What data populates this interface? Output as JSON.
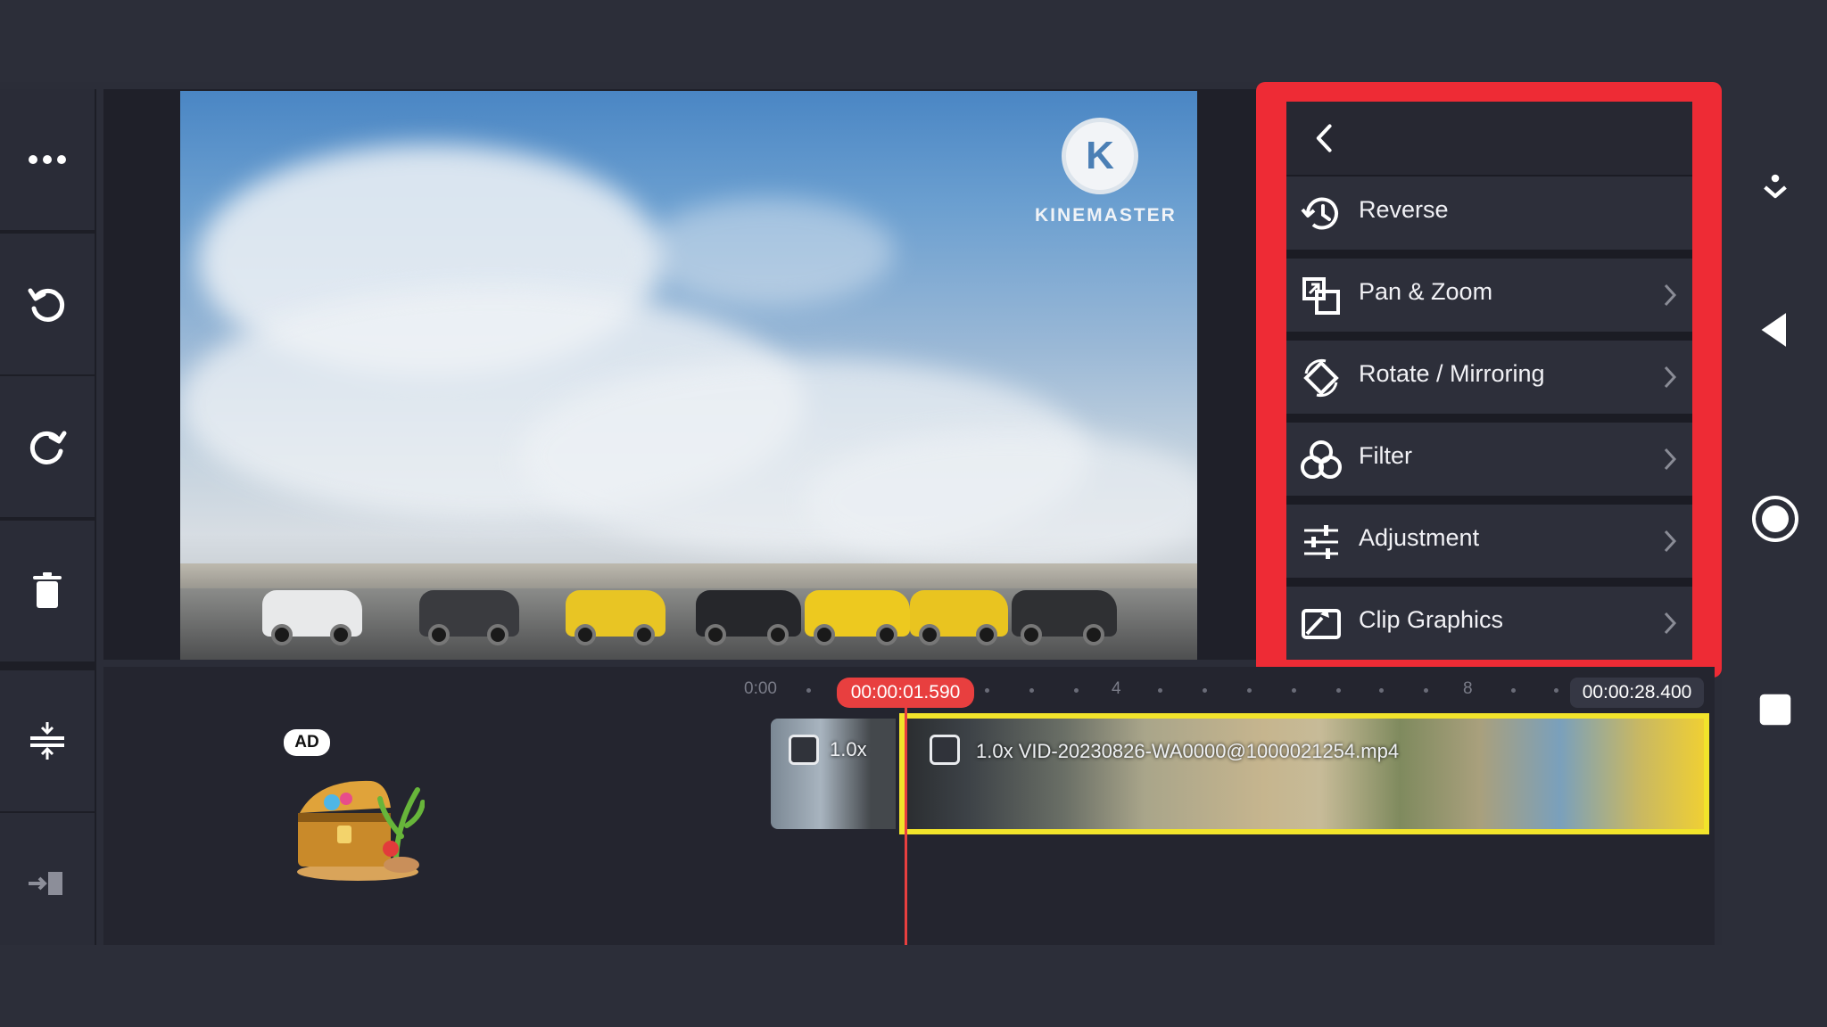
{
  "app": {
    "brand_logo_letter": "K",
    "brand_name": "KINEMASTER"
  },
  "left_toolbar": {
    "items": [
      {
        "icon": "more-icon"
      },
      {
        "icon": "undo-icon"
      },
      {
        "icon": "redo-icon"
      },
      {
        "icon": "trash-icon"
      },
      {
        "icon": "layer-adjust-icon"
      },
      {
        "icon": "trim-arrow-icon"
      }
    ]
  },
  "panel": {
    "back_icon": "chevron-left-icon",
    "items": [
      {
        "label": "Reverse",
        "icon": "reverse-clock-icon",
        "has_submenu": false
      },
      {
        "label": "Pan & Zoom",
        "icon": "pan-zoom-icon",
        "has_submenu": true
      },
      {
        "label": "Rotate / Mirroring",
        "icon": "rotate-icon",
        "has_submenu": true
      },
      {
        "label": "Filter",
        "icon": "filter-icon",
        "has_submenu": true
      },
      {
        "label": "Adjustment",
        "icon": "sliders-icon",
        "has_submenu": true
      },
      {
        "label": "Clip Graphics",
        "icon": "clip-graphics-icon",
        "has_submenu": true
      }
    ],
    "highlight_color": "#ee2b35"
  },
  "right_toolbar": {
    "items": [
      {
        "icon": "download-icon"
      },
      {
        "icon": "back-triangle-icon"
      },
      {
        "icon": "home-circle-icon"
      },
      {
        "icon": "recent-square-icon"
      }
    ]
  },
  "timeline": {
    "ruler": {
      "start": "0:00",
      "mark_4": "4",
      "mark_8": "8"
    },
    "current_time": "00:00:01.590",
    "end_time": "00:00:28.400",
    "clips": [
      {
        "speed_label": "1.0x"
      },
      {
        "speed_label": "1.0x VID-20230826-WA0000@1000021254.mp4"
      }
    ],
    "ad_badge": "AD",
    "playhead_color": "#e83f3f",
    "selected_clip_color": "#f2e42b"
  }
}
